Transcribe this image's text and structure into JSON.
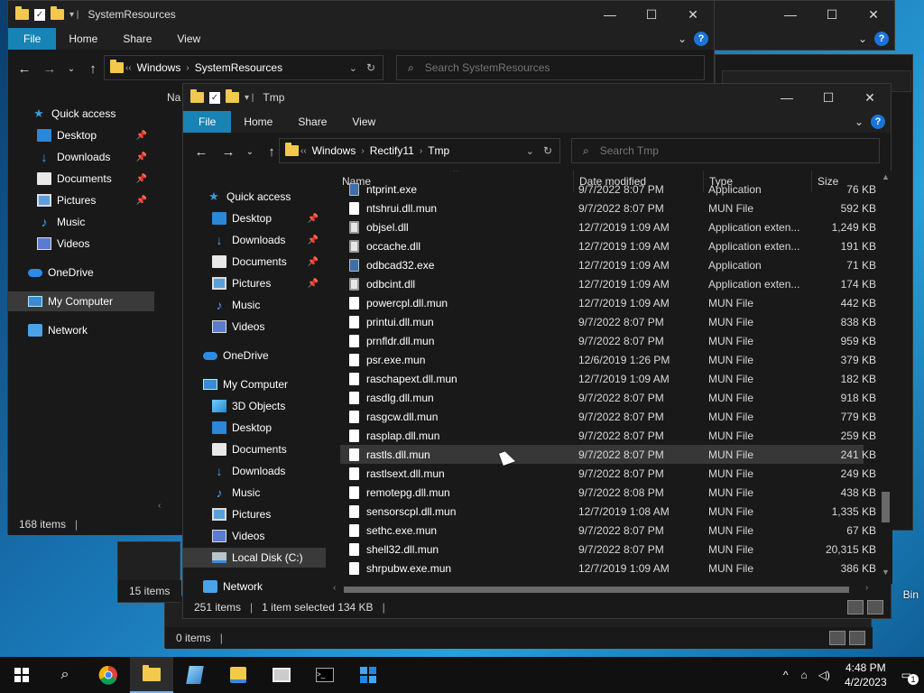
{
  "back_window": {
    "title": "SystemResources",
    "ribbon_tabs": [
      "File",
      "Home",
      "Share",
      "View"
    ],
    "crumbs": [
      "Windows",
      "SystemResources"
    ],
    "search_placeholder": "Search SystemResources",
    "sidebar": [
      {
        "label": "Quick access",
        "icon": "star-icon"
      },
      {
        "label": "Desktop",
        "icon": "desktop-icon",
        "pinned": true
      },
      {
        "label": "Downloads",
        "icon": "downloads-icon",
        "pinned": true
      },
      {
        "label": "Documents",
        "icon": "documents-icon",
        "pinned": true
      },
      {
        "label": "Pictures",
        "icon": "pictures-icon",
        "pinned": true
      },
      {
        "label": "Music",
        "icon": "music-icon"
      },
      {
        "label": "Videos",
        "icon": "videos-icon"
      },
      {
        "label": "OneDrive",
        "icon": "onedrive-icon"
      },
      {
        "label": "My Computer",
        "icon": "computer-icon",
        "selected": true
      },
      {
        "label": "Network",
        "icon": "network-icon"
      }
    ],
    "col_partial": "Na",
    "status_items": "168 items"
  },
  "mid_window": {
    "status_items": "15 items"
  },
  "bottom_window": {
    "status_items": "0 items"
  },
  "front_window": {
    "title": "Tmp",
    "ribbon_tabs": [
      "File",
      "Home",
      "Share",
      "View"
    ],
    "crumbs": [
      "Windows",
      "Rectify11",
      "Tmp"
    ],
    "search_placeholder": "Search Tmp",
    "sidebar": [
      {
        "label": "Quick access",
        "icon": "star-icon"
      },
      {
        "label": "Desktop",
        "icon": "desktop-icon",
        "pinned": true
      },
      {
        "label": "Downloads",
        "icon": "downloads-icon",
        "pinned": true
      },
      {
        "label": "Documents",
        "icon": "documents-icon",
        "pinned": true
      },
      {
        "label": "Pictures",
        "icon": "pictures-icon",
        "pinned": true
      },
      {
        "label": "Music",
        "icon": "music-icon"
      },
      {
        "label": "Videos",
        "icon": "videos-icon"
      },
      {
        "label": "OneDrive",
        "icon": "onedrive-icon"
      },
      {
        "label": "My Computer",
        "icon": "computer-icon"
      },
      {
        "label": "3D Objects",
        "icon": "3d-objects-icon"
      },
      {
        "label": "Desktop",
        "icon": "desktop-icon"
      },
      {
        "label": "Documents",
        "icon": "documents-icon"
      },
      {
        "label": "Downloads",
        "icon": "downloads-icon"
      },
      {
        "label": "Music",
        "icon": "music-icon"
      },
      {
        "label": "Pictures",
        "icon": "pictures-icon"
      },
      {
        "label": "Videos",
        "icon": "videos-icon"
      },
      {
        "label": "Local Disk (C:)",
        "icon": "local-disk-icon",
        "selected": true
      },
      {
        "label": "Network",
        "icon": "network-icon"
      }
    ],
    "columns": [
      "Name",
      "Date modified",
      "Type",
      "Size"
    ],
    "files": [
      {
        "name": "ntprint.exe",
        "date": "9/7/2022 8:07 PM",
        "type": "Application",
        "size": "76 KB",
        "kind": "exe"
      },
      {
        "name": "ntshrui.dll.mun",
        "date": "9/7/2022 8:07 PM",
        "type": "MUN File",
        "size": "592 KB",
        "kind": "file"
      },
      {
        "name": "objsel.dll",
        "date": "12/7/2019 1:09 AM",
        "type": "Application exten...",
        "size": "1,249 KB",
        "kind": "dll"
      },
      {
        "name": "occache.dll",
        "date": "12/7/2019 1:09 AM",
        "type": "Application exten...",
        "size": "191 KB",
        "kind": "dll"
      },
      {
        "name": "odbcad32.exe",
        "date": "12/7/2019 1:09 AM",
        "type": "Application",
        "size": "71 KB",
        "kind": "exe"
      },
      {
        "name": "odbcint.dll",
        "date": "12/7/2019 1:09 AM",
        "type": "Application exten...",
        "size": "174 KB",
        "kind": "dll"
      },
      {
        "name": "powercpl.dll.mun",
        "date": "12/7/2019 1:09 AM",
        "type": "MUN File",
        "size": "442 KB",
        "kind": "file"
      },
      {
        "name": "printui.dll.mun",
        "date": "9/7/2022 8:07 PM",
        "type": "MUN File",
        "size": "838 KB",
        "kind": "file"
      },
      {
        "name": "prnfldr.dll.mun",
        "date": "9/7/2022 8:07 PM",
        "type": "MUN File",
        "size": "959 KB",
        "kind": "file"
      },
      {
        "name": "psr.exe.mun",
        "date": "12/6/2019 1:26 PM",
        "type": "MUN File",
        "size": "379 KB",
        "kind": "file"
      },
      {
        "name": "raschapext.dll.mun",
        "date": "12/7/2019 1:09 AM",
        "type": "MUN File",
        "size": "182 KB",
        "kind": "file"
      },
      {
        "name": "rasdlg.dll.mun",
        "date": "9/7/2022 8:07 PM",
        "type": "MUN File",
        "size": "918 KB",
        "kind": "file"
      },
      {
        "name": "rasgcw.dll.mun",
        "date": "9/7/2022 8:07 PM",
        "type": "MUN File",
        "size": "779 KB",
        "kind": "file"
      },
      {
        "name": "rasplap.dll.mun",
        "date": "9/7/2022 8:07 PM",
        "type": "MUN File",
        "size": "259 KB",
        "kind": "file"
      },
      {
        "name": "rastls.dll.mun",
        "date": "9/7/2022 8:07 PM",
        "type": "MUN File",
        "size": "241 KB",
        "kind": "file",
        "selected": true
      },
      {
        "name": "rastlsext.dll.mun",
        "date": "9/7/2022 8:07 PM",
        "type": "MUN File",
        "size": "249 KB",
        "kind": "file"
      },
      {
        "name": "remotepg.dll.mun",
        "date": "9/7/2022 8:08 PM",
        "type": "MUN File",
        "size": "438 KB",
        "kind": "file"
      },
      {
        "name": "sensorscpl.dll.mun",
        "date": "12/7/2019 1:08 AM",
        "type": "MUN File",
        "size": "1,335 KB",
        "kind": "file"
      },
      {
        "name": "sethc.exe.mun",
        "date": "9/7/2022 8:07 PM",
        "type": "MUN File",
        "size": "67 KB",
        "kind": "file"
      },
      {
        "name": "shell32.dll.mun",
        "date": "9/7/2022 8:07 PM",
        "type": "MUN File",
        "size": "20,315 KB",
        "kind": "file"
      },
      {
        "name": "shrpubw.exe.mun",
        "date": "12/7/2019 1:09 AM",
        "type": "MUN File",
        "size": "386 KB",
        "kind": "file"
      }
    ],
    "status_items": "251 items",
    "status_selected": "1 item selected  134 KB"
  },
  "desktop": {
    "recycle_partial": "Bin"
  },
  "taskbar": {
    "time": "4:48 PM",
    "date": "4/2/2023",
    "notification_count": "1"
  },
  "colors": {
    "accent": "#1883b5",
    "window_bg": "#191919",
    "selected_row": "#373737"
  }
}
